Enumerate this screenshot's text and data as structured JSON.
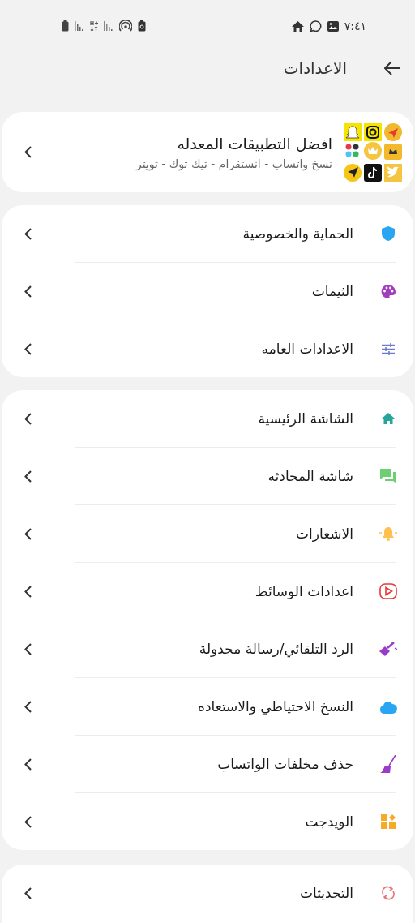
{
  "status_bar": {
    "time": "٧:٤١"
  },
  "header": {
    "title": "الاعدادات"
  },
  "promo": {
    "title": "افضل التطبيقات المعدله",
    "subtitle": "نسخ واتساب - انستقرام - تيك توك - تويتر"
  },
  "groups": [
    {
      "items": [
        {
          "label": "الحماية والخصوصية",
          "kind": "shield"
        },
        {
          "label": "الثيمات",
          "kind": "palette"
        },
        {
          "label": "الاعدادات العامه",
          "kind": "sliders"
        }
      ]
    },
    {
      "items": [
        {
          "label": "الشاشة الرئيسية",
          "kind": "home"
        },
        {
          "label": "شاشة المحادثه",
          "kind": "chat"
        },
        {
          "label": "الاشعارات",
          "kind": "bell"
        },
        {
          "label": "اعدادات الوسائط",
          "kind": "play"
        },
        {
          "label": "الرد التلقائي/رسالة مجدولة",
          "kind": "wand"
        },
        {
          "label": "النسخ الاحتياطي والاستعاده",
          "kind": "cloud"
        },
        {
          "label": "حذف مخلفات الواتساب",
          "kind": "broom"
        },
        {
          "label": "الويدجت",
          "kind": "widgets"
        }
      ]
    },
    {
      "items": [
        {
          "label": "التحديثات",
          "kind": "refresh"
        }
      ]
    }
  ]
}
